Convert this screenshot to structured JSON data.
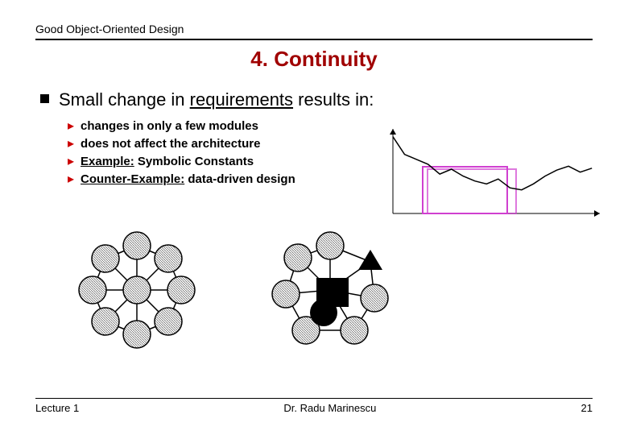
{
  "header": "Good Object-Oriented Design",
  "title": "4. Continuity",
  "bullet1_prefix": "Small change in ",
  "bullet1_emph": "requirements",
  "bullet1_suffix": " results in:",
  "subs": {
    "a": "changes in only a few modules",
    "b": "does not affect the architecture",
    "c_label": "Example:",
    "c_text": " Symbolic Constants",
    "d_label": "Counter-Example:",
    "d_text": " data-driven design"
  },
  "footer": {
    "left": "Lecture 1",
    "center": "Dr. Radu Marinescu",
    "right": "21"
  },
  "chart_data": {
    "type": "line",
    "title": "",
    "xlabel": "",
    "ylabel": "",
    "x": [
      0,
      15,
      30,
      45,
      60,
      75,
      90,
      105,
      120,
      135,
      150,
      165,
      180,
      195,
      210,
      225,
      240,
      255
    ],
    "values": [
      78,
      60,
      55,
      50,
      40,
      45,
      38,
      33,
      30,
      35,
      26,
      24,
      30,
      38,
      44,
      48,
      42,
      46
    ],
    "highlight_window_x": [
      45,
      150
    ],
    "ylim": [
      0,
      90
    ],
    "xlim": [
      0,
      260
    ]
  }
}
